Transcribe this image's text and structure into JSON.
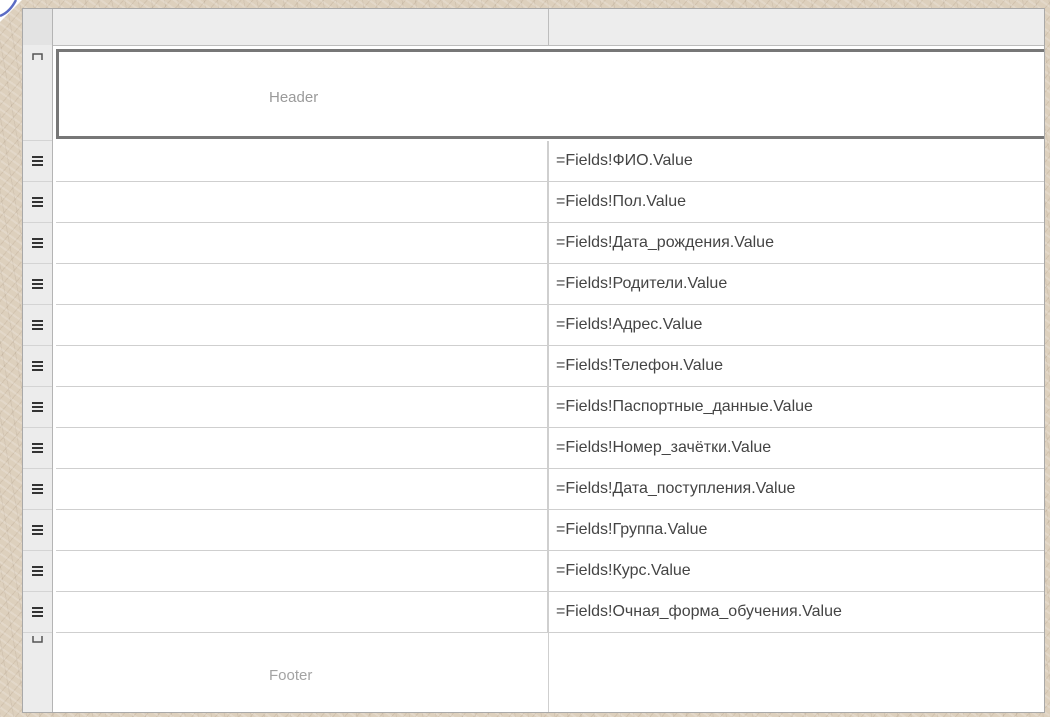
{
  "layout": {
    "header_label": "Header",
    "footer_label": "Footer"
  },
  "detail_rows": [
    {
      "expression": "=Fields!ФИО.Value"
    },
    {
      "expression": "=Fields!Пол.Value"
    },
    {
      "expression": "=Fields!Дата_рождения.Value"
    },
    {
      "expression": "=Fields!Родители.Value"
    },
    {
      "expression": "=Fields!Адрес.Value"
    },
    {
      "expression": "=Fields!Телефон.Value"
    },
    {
      "expression": "=Fields!Паспортные_данные.Value"
    },
    {
      "expression": "=Fields!Номер_зачётки.Value"
    },
    {
      "expression": "=Fields!Дата_поступления.Value"
    },
    {
      "expression": "=Fields!Группа.Value"
    },
    {
      "expression": "=Fields!Курс.Value"
    },
    {
      "expression": "=Fields!Очная_форма_обучения.Value"
    }
  ],
  "icons": {
    "header_handle": "header-row-handle-icon",
    "detail_handle": "detail-row-handle-icon",
    "footer_handle": "footer-row-handle-icon"
  },
  "colors": {
    "background": "#ddd0bd",
    "grid_line": "#cfcfcf",
    "header_border": "#777777",
    "field_text": "#444444"
  }
}
